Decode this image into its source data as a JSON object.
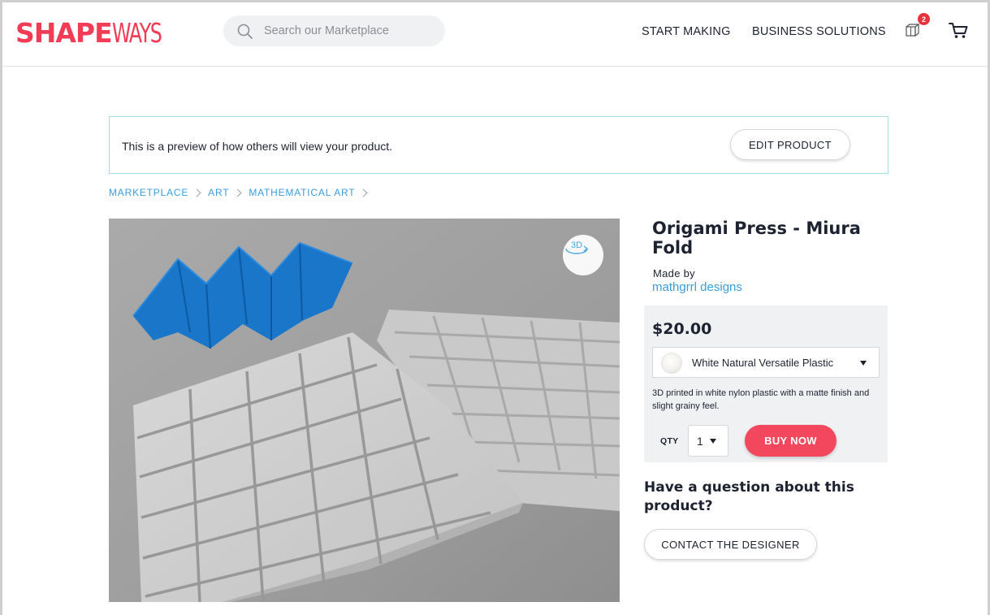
{
  "header": {
    "logo_part1": "SHAPE",
    "logo_part2": "WAYS",
    "search_placeholder": "Search our Marketplace",
    "nav": [
      "START MAKING",
      "BUSINESS SOLUTIONS"
    ],
    "notification_count": "2",
    "brand_color": "#f23c56"
  },
  "preview_bar": {
    "message": "This is a preview of how others will view your product.",
    "edit_button": "EDIT PRODUCT"
  },
  "breadcrumb": [
    "MARKETPLACE",
    "ART",
    "MATHEMATICAL ART"
  ],
  "product": {
    "view_3d_label": "3D",
    "title": "Origami Press - Miura Fold",
    "made_by_label": "Made by",
    "designer": "mathgrrl designs",
    "price": "$20.00",
    "material": "White Natural Versatile Plastic",
    "description": "3D printed in white nylon plastic with a matte finish and slight grainy feel.",
    "qty_label": "QTY",
    "qty_value": "1",
    "buy_button": "BUY NOW",
    "accent_color": "#f2475c",
    "link_color": "#3b9dd8"
  },
  "question": {
    "heading": "Have a question about this product?",
    "contact_button": "CONTACT THE DESIGNER"
  }
}
